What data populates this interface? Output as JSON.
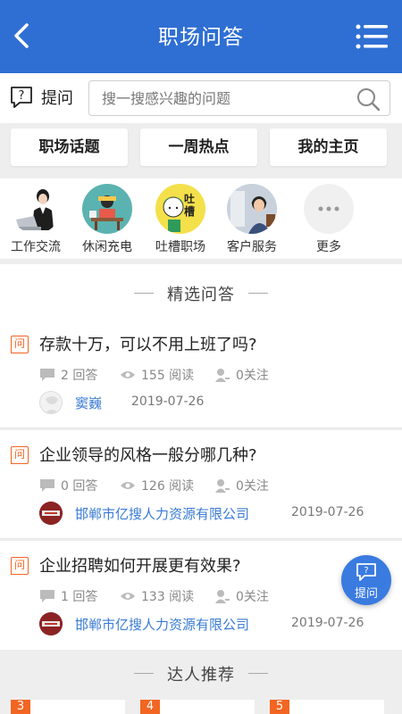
{
  "header": {
    "title": "职场问答",
    "back_icon": "back-chevron-icon",
    "menu_icon": "menu-list-icon",
    "color": "#2f6fd3"
  },
  "search": {
    "ask_label": "提问",
    "placeholder": "搜一搜感兴趣的问题"
  },
  "tabs": [
    {
      "label": "职场话题"
    },
    {
      "label": "一周热点"
    },
    {
      "label": "我的主页"
    }
  ],
  "categories": [
    {
      "label": "工作交流",
      "icon": "office-woman-laptop"
    },
    {
      "label": "休闲充电",
      "icon": "relax-desk-person"
    },
    {
      "label": "吐槽职场",
      "icon": "complain-person",
      "badge_text": "吐槽"
    },
    {
      "label": "客户服务",
      "icon": "customer-service-headset"
    },
    {
      "label": "更多",
      "icon": "more-dots-icon"
    }
  ],
  "featured_section": {
    "title": "精选问答"
  },
  "questions": [
    {
      "badge": "问",
      "title": "存款十万，可以不用上班了吗?",
      "answers": "2 回答",
      "views": "155 阅读",
      "follows": "0关注",
      "author": "窦巍",
      "date": "2019-07-26"
    },
    {
      "badge": "问",
      "title": "企业领导的风格一般分哪几种?",
      "answers": "0 回答",
      "views": "126 阅读",
      "follows": "0关注",
      "author": "邯郸市亿搜人力资源有限公司",
      "date": "2019-07-26"
    },
    {
      "badge": "问",
      "title": "企业招聘如何开展更有效果?",
      "answers": "1 回答",
      "views": "133 阅读",
      "follows": "0关注",
      "author": "邯郸市亿搜人力资源有限公司",
      "date": "2019-07-26"
    }
  ],
  "fab": {
    "label": "提问"
  },
  "expert_section": {
    "title": "达人推荐",
    "ranks": [
      "3",
      "4",
      "5"
    ]
  },
  "colors": {
    "accent": "#2f6fd3",
    "badge_orange": "#f26522",
    "link_blue": "#3a7bd5"
  }
}
